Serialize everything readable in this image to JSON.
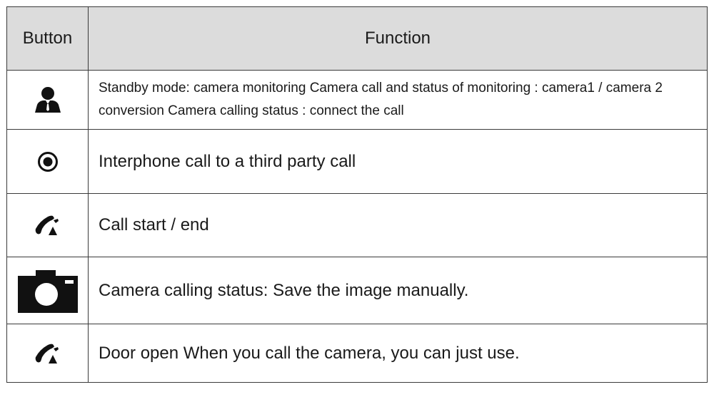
{
  "table": {
    "header": {
      "button": "Button",
      "function": "Function"
    },
    "rows": [
      {
        "icon": "person-icon",
        "function": "Standby mode: camera monitoring Camera call and status of monitoring : camera1 / camera 2 conversion Camera calling status : connect the call"
      },
      {
        "icon": "record-circle-icon",
        "function": "Interphone call to a third party call"
      },
      {
        "icon": "phone-handset-icon",
        "function": "Call start / end"
      },
      {
        "icon": "camera-icon",
        "function": "Camera calling status: Save the image manually."
      },
      {
        "icon": "phone-handset-icon",
        "function": "Door open When you call the camera, you can just use."
      }
    ]
  },
  "colors": {
    "header_bg": "#dcdcdc",
    "border": "#3a3a3a",
    "icon": "#111111"
  }
}
